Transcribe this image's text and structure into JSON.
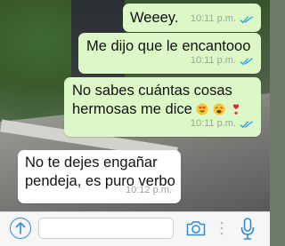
{
  "messages": [
    {
      "direction": "outgoing",
      "text": "Weeey.",
      "time": "10:11 p.m.",
      "status": "read"
    },
    {
      "direction": "outgoing",
      "text": "Me dijo que le encantooo",
      "time": "10:11 p.m.",
      "status": "read"
    },
    {
      "direction": "outgoing",
      "text": "No sabes cuántas cosas hermosas me dice",
      "emojis": [
        "heart-eyes-emoji",
        "weary-emoji",
        "heart-exclamation-emoji"
      ],
      "time": "10:11 p.m.",
      "status": "read"
    },
    {
      "direction": "incoming",
      "text": "No te dejes engañar pendeja, es puro verbo",
      "time": "10:12 p.m."
    }
  ],
  "composer": {
    "placeholder": "",
    "icons": [
      "upload-icon",
      "camera-icon",
      "dots-icon",
      "microphone-icon"
    ]
  },
  "colors": {
    "outgoing_bubble": "#dcf8c6",
    "incoming_bubble": "#ffffff",
    "read_ticks": "#34a3e8",
    "accent": "#2b8bd6"
  }
}
